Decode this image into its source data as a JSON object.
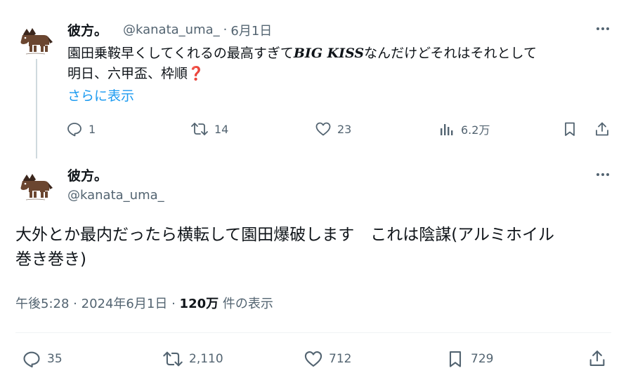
{
  "reply_tweet": {
    "author": {
      "name": "彼方。",
      "handle": "@kanata_uma_"
    },
    "separator": "·",
    "date": "6月1日",
    "text_before": "園田乗鞍早くしてくれるの最高すぎて",
    "text_emphasis": "BIG KISS",
    "text_after": "なんだけどそれはそれとして",
    "text_line2": "明日、六甲盃、枠順",
    "emoji": "❓",
    "show_more": "さらに表示",
    "stats": {
      "replies": "1",
      "retweets": "14",
      "likes": "23",
      "views": "6.2万"
    }
  },
  "main_tweet": {
    "author": {
      "name": "彼方。",
      "handle": "@kanata_uma_"
    },
    "text_line1": "大外とか最内だったら横転して園田爆破します　これは陰謀(アルミホイル",
    "text_line2": "巻き巻き)",
    "meta": {
      "time": "午後5:28",
      "separator": "·",
      "date": "2024年6月1日",
      "views_count": "120万",
      "views_label": "件の表示"
    },
    "stats": {
      "replies": "35",
      "retweets": "2,110",
      "likes": "712",
      "bookmarks": "729"
    }
  },
  "icons": [
    "horse-avatar-icon",
    "more-icon",
    "reply-icon",
    "retweet-icon",
    "like-icon",
    "views-icon",
    "bookmark-icon",
    "share-icon"
  ],
  "colors": {
    "text": "#0f1419",
    "secondary": "#536471",
    "link": "#1d9bf0",
    "thread_line": "#cfd9de",
    "divider": "#eff3f4"
  }
}
